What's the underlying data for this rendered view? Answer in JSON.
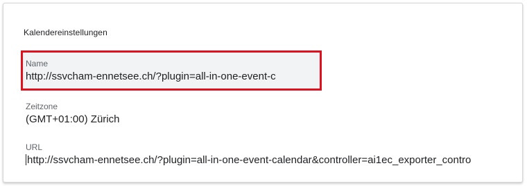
{
  "section": {
    "title": "Kalendereinstellungen"
  },
  "fields": {
    "name": {
      "label": "Name",
      "value": "http://ssvcham-ennetsee.ch/?plugin=all-in-one-event-c"
    },
    "timezone": {
      "label": "Zeitzone",
      "value": "(GMT+01:00) Zürich"
    },
    "url": {
      "label": "URL",
      "value": "http://ssvcham-ennetsee.ch/?plugin=all-in-one-event-calendar&controller=ai1ec_exporter_contro"
    }
  },
  "colors": {
    "highlight": "#e0101f",
    "field_background": "#f1f3f4",
    "label": "#5f6368",
    "text": "#202124"
  }
}
